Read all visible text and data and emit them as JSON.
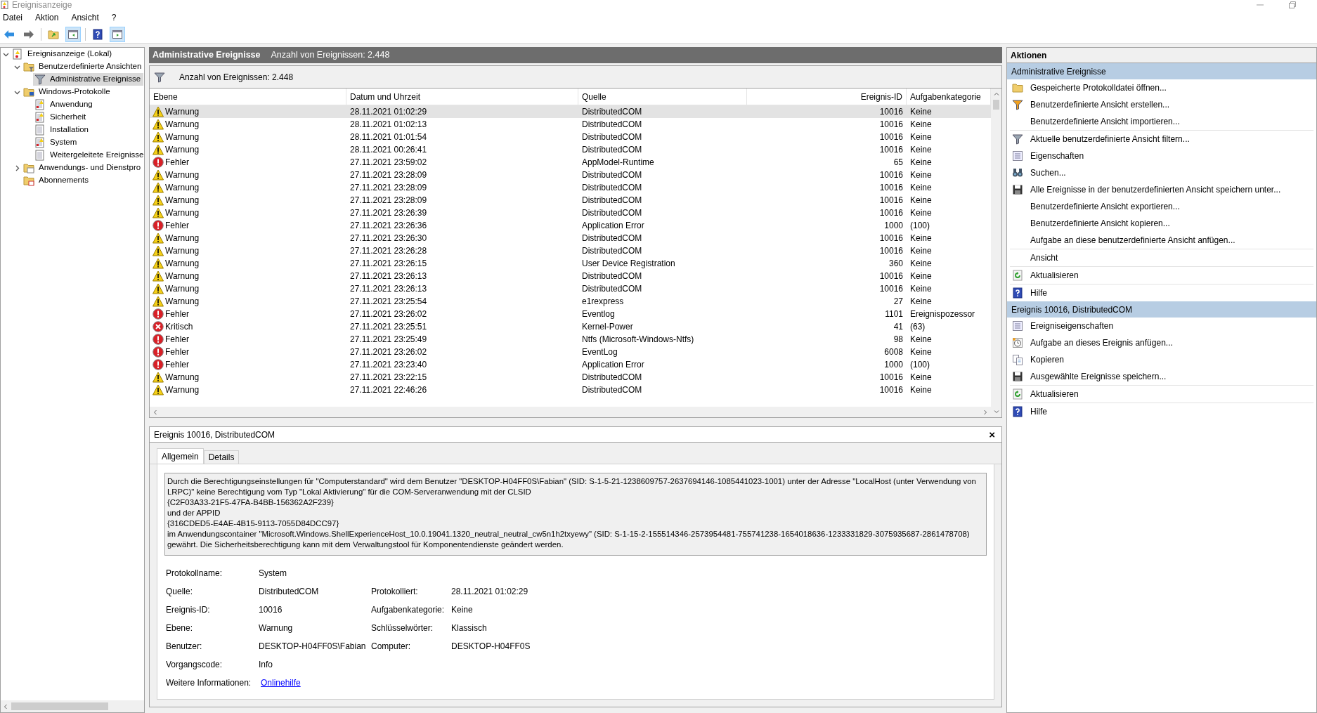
{
  "window": {
    "title": "Ereignisanzeige"
  },
  "menu": [
    "Datei",
    "Aktion",
    "Ansicht",
    "?"
  ],
  "toolbar": [
    {
      "kind": "back",
      "selected": false
    },
    {
      "kind": "forward",
      "selected": false
    },
    {
      "kind": "sep"
    },
    {
      "kind": "folder-up",
      "selected": false
    },
    {
      "kind": "pane-left",
      "selected": true
    },
    {
      "kind": "sep"
    },
    {
      "kind": "help",
      "selected": false
    },
    {
      "kind": "pane-right",
      "selected": true
    }
  ],
  "tree": [
    {
      "label": "Ereignisanzeige (Lokal)",
      "kind": "viewer",
      "expanded": true,
      "selected": false,
      "children": [
        {
          "label": "Benutzerdefinierte Ansichten",
          "kind": "folder-filter",
          "expanded": true,
          "selected": false,
          "children": [
            {
              "label": "Administrative Ereignisse",
              "kind": "filter",
              "selected": true
            }
          ]
        },
        {
          "label": "Windows-Protokolle",
          "kind": "folder-pc",
          "expanded": true,
          "selected": false,
          "children": [
            {
              "label": "Anwendung",
              "kind": "log-alert",
              "selected": false
            },
            {
              "label": "Sicherheit",
              "kind": "log-alert",
              "selected": false
            },
            {
              "label": "Installation",
              "kind": "log",
              "selected": false
            },
            {
              "label": "System",
              "kind": "log-alert",
              "selected": false
            },
            {
              "label": "Weitergeleitete Ereignisse",
              "kind": "log",
              "selected": false
            }
          ]
        },
        {
          "label": "Anwendungs- und Dienstpro",
          "kind": "folder-app",
          "expanded": false,
          "selected": false
        },
        {
          "label": "Abonnements",
          "kind": "folder-sub",
          "selected": false
        }
      ]
    }
  ],
  "view": {
    "title": "Administrative Ereignisse",
    "count": "Anzahl von Ereignissen: 2.448"
  },
  "filter_bar": {
    "text": "Anzahl von Ereignissen: 2.448"
  },
  "table": {
    "columns": [
      "Ebene",
      "Datum und Uhrzeit",
      "Quelle",
      "Ereignis-ID",
      "Aufgabenkategorie"
    ],
    "rows": [
      {
        "level": "Warnung",
        "kind": "warning",
        "date": "28.11.2021 01:02:29",
        "source": "DistributedCOM",
        "id": "10016",
        "category": "Keine",
        "selected": true
      },
      {
        "level": "Warnung",
        "kind": "warning",
        "date": "28.11.2021 01:02:13",
        "source": "DistributedCOM",
        "id": "10016",
        "category": "Keine",
        "selected": false
      },
      {
        "level": "Warnung",
        "kind": "warning",
        "date": "28.11.2021 01:01:54",
        "source": "DistributedCOM",
        "id": "10016",
        "category": "Keine",
        "selected": false
      },
      {
        "level": "Warnung",
        "kind": "warning",
        "date": "28.11.2021 00:26:41",
        "source": "DistributedCOM",
        "id": "10016",
        "category": "Keine",
        "selected": false
      },
      {
        "level": "Fehler",
        "kind": "error",
        "date": "27.11.2021 23:59:02",
        "source": "AppModel-Runtime",
        "id": "65",
        "category": "Keine",
        "selected": false
      },
      {
        "level": "Warnung",
        "kind": "warning",
        "date": "27.11.2021 23:28:09",
        "source": "DistributedCOM",
        "id": "10016",
        "category": "Keine",
        "selected": false
      },
      {
        "level": "Warnung",
        "kind": "warning",
        "date": "27.11.2021 23:28:09",
        "source": "DistributedCOM",
        "id": "10016",
        "category": "Keine",
        "selected": false
      },
      {
        "level": "Warnung",
        "kind": "warning",
        "date": "27.11.2021 23:28:09",
        "source": "DistributedCOM",
        "id": "10016",
        "category": "Keine",
        "selected": false
      },
      {
        "level": "Warnung",
        "kind": "warning",
        "date": "27.11.2021 23:26:39",
        "source": "DistributedCOM",
        "id": "10016",
        "category": "Keine",
        "selected": false
      },
      {
        "level": "Fehler",
        "kind": "error",
        "date": "27.11.2021 23:26:36",
        "source": "Application Error",
        "id": "1000",
        "category": "(100)",
        "selected": false
      },
      {
        "level": "Warnung",
        "kind": "warning",
        "date": "27.11.2021 23:26:30",
        "source": "DistributedCOM",
        "id": "10016",
        "category": "Keine",
        "selected": false
      },
      {
        "level": "Warnung",
        "kind": "warning",
        "date": "27.11.2021 23:26:28",
        "source": "DistributedCOM",
        "id": "10016",
        "category": "Keine",
        "selected": false
      },
      {
        "level": "Warnung",
        "kind": "warning",
        "date": "27.11.2021 23:26:15",
        "source": "User Device Registration",
        "id": "360",
        "category": "Keine",
        "selected": false
      },
      {
        "level": "Warnung",
        "kind": "warning",
        "date": "27.11.2021 23:26:13",
        "source": "DistributedCOM",
        "id": "10016",
        "category": "Keine",
        "selected": false
      },
      {
        "level": "Warnung",
        "kind": "warning",
        "date": "27.11.2021 23:26:13",
        "source": "DistributedCOM",
        "id": "10016",
        "category": "Keine",
        "selected": false
      },
      {
        "level": "Warnung",
        "kind": "warning",
        "date": "27.11.2021 23:25:54",
        "source": "e1rexpress",
        "id": "27",
        "category": "Keine",
        "selected": false
      },
      {
        "level": "Fehler",
        "kind": "error",
        "date": "27.11.2021 23:26:02",
        "source": "Eventlog",
        "id": "1101",
        "category": "Ereignispozessor",
        "selected": false
      },
      {
        "level": "Kritisch",
        "kind": "critical",
        "date": "27.11.2021 23:25:51",
        "source": "Kernel-Power",
        "id": "41",
        "category": "(63)",
        "selected": false
      },
      {
        "level": "Fehler",
        "kind": "error",
        "date": "27.11.2021 23:25:49",
        "source": "Ntfs (Microsoft-Windows-Ntfs)",
        "id": "98",
        "category": "Keine",
        "selected": false
      },
      {
        "level": "Fehler",
        "kind": "error",
        "date": "27.11.2021 23:26:02",
        "source": "EventLog",
        "id": "6008",
        "category": "Keine",
        "selected": false
      },
      {
        "level": "Fehler",
        "kind": "error",
        "date": "27.11.2021 23:23:40",
        "source": "Application Error",
        "id": "1000",
        "category": "(100)",
        "selected": false
      },
      {
        "level": "Warnung",
        "kind": "warning",
        "date": "27.11.2021 23:22:15",
        "source": "DistributedCOM",
        "id": "10016",
        "category": "Keine",
        "selected": false
      },
      {
        "level": "Warnung",
        "kind": "warning",
        "date": "27.11.2021 22:46:26",
        "source": "DistributedCOM",
        "id": "10016",
        "category": "Keine",
        "selected": false
      }
    ]
  },
  "detail": {
    "title": "Ereignis 10016, DistributedCOM",
    "close": "×",
    "tabs": [
      {
        "label": "Allgemein",
        "selected": true
      },
      {
        "label": "Details",
        "selected": false
      }
    ],
    "description": "Durch die Berechtigungseinstellungen für \"Computerstandard\" wird dem Benutzer \"DESKTOP-H04FF0S\\Fabian\" (SID: S-1-5-21-1238609757-2637694146-1085441023-1001) unter der Adresse \"LocalHost (unter Verwendung von LRPC)\" keine Berechtigung vom Typ \"Lokal Aktivierung\" für die COM-Serveranwendung mit der CLSID\n{C2F03A33-21F5-47FA-B4BB-156362A2F239}\n und der APPID\n{316CDED5-E4AE-4B15-9113-7055D84DCC97}\n im Anwendungscontainer \"Microsoft.Windows.ShellExperienceHost_10.0.19041.1320_neutral_neutral_cw5n1h2txyewy\" (SID: S-1-15-2-155514346-2573954481-755741238-1654018636-1233331829-3075935687-2861478708) gewährt. Die Sicherheitsberechtigung kann mit dem Verwaltungstool für Komponentendienste geändert werden.",
    "fields": [
      {
        "left": {
          "label": "Protokollname:",
          "value": "System",
          "kind": "text"
        }
      },
      {
        "left": {
          "label": "Quelle:",
          "value": "DistributedCOM",
          "kind": "text"
        },
        "right": {
          "label": "Protokolliert:",
          "value": "28.11.2021 01:02:29"
        }
      },
      {
        "left": {
          "label": "Ereignis-ID:",
          "value": "10016",
          "kind": "text"
        },
        "right": {
          "label": "Aufgabenkategorie:",
          "value": "Keine"
        }
      },
      {
        "left": {
          "label": "Ebene:",
          "value": "Warnung",
          "kind": "text"
        },
        "right": {
          "label": "Schlüsselwörter:",
          "value": "Klassisch"
        }
      },
      {
        "left": {
          "label": "Benutzer:",
          "value": "DESKTOP-H04FF0S\\Fabian",
          "kind": "text"
        },
        "right": {
          "label": "Computer:",
          "value": "DESKTOP-H04FF0S"
        }
      },
      {
        "left": {
          "label": "Vorgangscode:",
          "value": "Info",
          "kind": "text"
        }
      },
      {
        "left": {
          "label": "Weitere Informationen:",
          "value": "Onlinehilfe",
          "kind": "link"
        }
      }
    ]
  },
  "actions": {
    "title": "Aktionen",
    "sections": [
      {
        "title": "Administrative Ereignisse",
        "groups": [
          [
            {
              "label": "Gespeicherte Protokolldatei öffnen...",
              "kind": "folder"
            },
            {
              "label": "Benutzerdefinierte Ansicht erstellen...",
              "kind": "filter-new"
            },
            {
              "label": "Benutzerdefinierte Ansicht importieren...",
              "kind": "none"
            }
          ],
          [
            {
              "label": "Aktuelle benutzerdefinierte Ansicht filtern...",
              "kind": "filter"
            },
            {
              "label": "Eigenschaften",
              "kind": "properties"
            },
            {
              "label": "Suchen...",
              "kind": "find"
            },
            {
              "label": "Alle Ereignisse in der benutzerdefinierten Ansicht speichern unter...",
              "kind": "save"
            },
            {
              "label": "Benutzerdefinierte Ansicht exportieren...",
              "kind": "none"
            },
            {
              "label": "Benutzerdefinierte Ansicht kopieren...",
              "kind": "none"
            },
            {
              "label": "Aufgabe an diese benutzerdefinierte Ansicht anfügen...",
              "kind": "none"
            }
          ],
          [
            {
              "label": "Ansicht",
              "kind": "none"
            }
          ],
          [
            {
              "label": "Aktualisieren",
              "kind": "refresh"
            }
          ],
          [
            {
              "label": "Hilfe",
              "kind": "help"
            }
          ]
        ]
      },
      {
        "title": "Ereignis 10016, DistributedCOM",
        "groups": [
          [
            {
              "label": "Ereigniseigenschaften",
              "kind": "properties"
            },
            {
              "label": "Aufgabe an dieses Ereignis anfügen...",
              "kind": "task"
            },
            {
              "label": "Kopieren",
              "kind": "copy"
            },
            {
              "label": "Ausgewählte Ereignisse speichern...",
              "kind": "save"
            }
          ],
          [
            {
              "label": "Aktualisieren",
              "kind": "refresh"
            }
          ],
          [
            {
              "label": "Hilfe",
              "kind": "help"
            }
          ]
        ]
      }
    ]
  }
}
